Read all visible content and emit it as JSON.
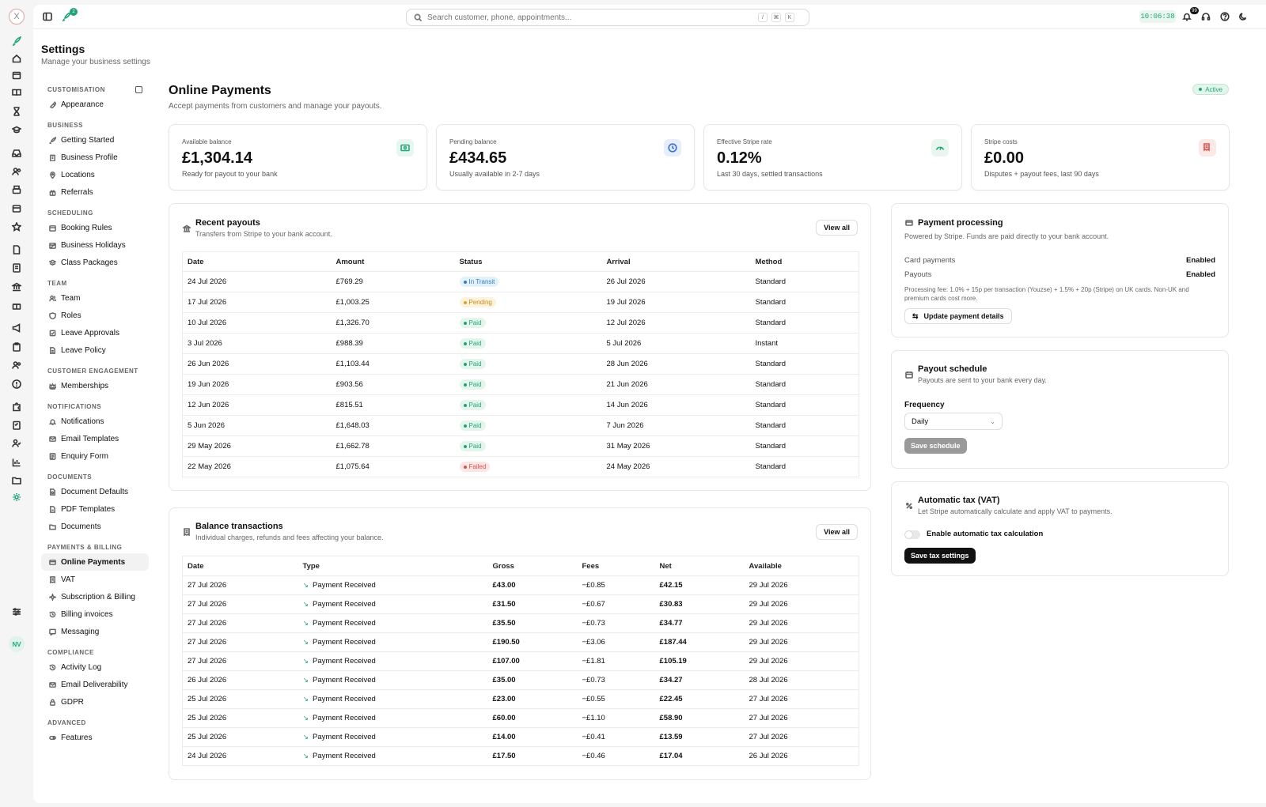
{
  "topbar": {
    "notif_count": "2",
    "search_placeholder": "Search customer, phone, appointments...",
    "kbd1": "/",
    "kbd2": "⌘",
    "kbd3": "K",
    "clock": "10:06:38",
    "bell_count": "99"
  },
  "rail": {
    "logo": "X",
    "avatar": "NV"
  },
  "settings": {
    "title": "Settings",
    "subtitle": "Manage your business settings"
  },
  "sidebar": [
    {
      "label": "CUSTOMISATION",
      "items": [
        {
          "label": "Appearance",
          "icon": "brush-icon"
        }
      ]
    },
    {
      "label": "BUSINESS",
      "items": [
        {
          "label": "Getting Started",
          "icon": "rocket-icon"
        },
        {
          "label": "Business Profile",
          "icon": "building-icon"
        },
        {
          "label": "Locations",
          "icon": "pin-icon"
        },
        {
          "label": "Referrals",
          "icon": "gift-icon"
        }
      ]
    },
    {
      "label": "SCHEDULING",
      "items": [
        {
          "label": "Booking Rules",
          "icon": "calendar-icon"
        },
        {
          "label": "Business Holidays",
          "icon": "calendar-off-icon"
        },
        {
          "label": "Class Packages",
          "icon": "layers-icon"
        }
      ]
    },
    {
      "label": "TEAM",
      "items": [
        {
          "label": "Team",
          "icon": "users-icon"
        },
        {
          "label": "Roles",
          "icon": "shield-icon"
        },
        {
          "label": "Leave Approvals",
          "icon": "check-square-icon"
        },
        {
          "label": "Leave Policy",
          "icon": "file-icon"
        }
      ]
    },
    {
      "label": "CUSTOMER ENGAGEMENT",
      "items": [
        {
          "label": "Memberships",
          "icon": "crown-icon"
        }
      ]
    },
    {
      "label": "NOTIFICATIONS",
      "items": [
        {
          "label": "Notifications",
          "icon": "bell-icon"
        },
        {
          "label": "Email Templates",
          "icon": "mail-icon"
        },
        {
          "label": "Enquiry Form",
          "icon": "form-icon"
        }
      ]
    },
    {
      "label": "DOCUMENTS",
      "items": [
        {
          "label": "Document Defaults",
          "icon": "file-settings-icon"
        },
        {
          "label": "PDF Templates",
          "icon": "pdf-icon"
        },
        {
          "label": "Documents",
          "icon": "folder-icon"
        }
      ]
    },
    {
      "label": "PAYMENTS & BILLING",
      "items": [
        {
          "label": "Online Payments",
          "icon": "credit-card-icon",
          "active": true
        },
        {
          "label": "VAT",
          "icon": "receipt-icon"
        },
        {
          "label": "Subscription & Billing",
          "icon": "sparkle-icon"
        },
        {
          "label": "Billing invoices",
          "icon": "history-icon"
        },
        {
          "label": "Messaging",
          "icon": "message-icon"
        }
      ]
    },
    {
      "label": "COMPLIANCE",
      "items": [
        {
          "label": "Activity Log",
          "icon": "history-icon"
        },
        {
          "label": "Email Deliverability",
          "icon": "mail-icon"
        },
        {
          "label": "GDPR",
          "icon": "lock-icon"
        }
      ]
    },
    {
      "label": "ADVANCED",
      "items": [
        {
          "label": "Features",
          "icon": "toggle-icon"
        }
      ]
    }
  ],
  "page": {
    "title": "Online Payments",
    "subtitle": "Accept payments from customers and manage your payouts.",
    "status": "Active"
  },
  "stats": [
    {
      "label": "Available balance",
      "value": "£1,304.14",
      "note": "Ready for payout to your bank",
      "icon": "cash-icon",
      "color": "#21a47b",
      "bg": "#e8f6ef"
    },
    {
      "label": "Pending balance",
      "value": "£434.65",
      "note": "Usually available in 2-7 days",
      "icon": "clock-icon",
      "color": "#3b6fd8",
      "bg": "#e6eefb"
    },
    {
      "label": "Effective Stripe rate",
      "value": "0.12%",
      "note": "Last 30 days, settled transactions",
      "icon": "gauge-icon",
      "color": "#21a47b",
      "bg": "#e8f6ef"
    },
    {
      "label": "Stripe costs",
      "value": "£0.00",
      "note": "Disputes + payout fees, last 90 days",
      "icon": "receipt-icon",
      "color": "#d9534f",
      "bg": "#fbe9e8"
    }
  ],
  "payouts": {
    "title": "Recent payouts",
    "subtitle": "Transfers from Stripe to your bank account.",
    "view_all": "View all",
    "columns": [
      "Date",
      "Amount",
      "Status",
      "Arrival",
      "Method"
    ],
    "rows": [
      {
        "date": "24 Jul 2026",
        "amount": "£769.29",
        "status": "In Transit",
        "arrival": "26 Jul 2026",
        "method": "Standard"
      },
      {
        "date": "17 Jul 2026",
        "amount": "£1,003.25",
        "status": "Pending",
        "arrival": "19 Jul 2026",
        "method": "Standard"
      },
      {
        "date": "10 Jul 2026",
        "amount": "£1,326.70",
        "status": "Paid",
        "arrival": "12 Jul 2026",
        "method": "Standard"
      },
      {
        "date": "3 Jul 2026",
        "amount": "£988.39",
        "status": "Paid",
        "arrival": "5 Jul 2026",
        "method": "Instant"
      },
      {
        "date": "26 Jun 2026",
        "amount": "£1,103.44",
        "status": "Paid",
        "arrival": "28 Jun 2026",
        "method": "Standard"
      },
      {
        "date": "19 Jun 2026",
        "amount": "£903.56",
        "status": "Paid",
        "arrival": "21 Jun 2026",
        "method": "Standard"
      },
      {
        "date": "12 Jun 2026",
        "amount": "£815.51",
        "status": "Paid",
        "arrival": "14 Jun 2026",
        "method": "Standard"
      },
      {
        "date": "5 Jun 2026",
        "amount": "£1,648.03",
        "status": "Paid",
        "arrival": "7 Jun 2026",
        "method": "Standard"
      },
      {
        "date": "29 May 2026",
        "amount": "£1,662.78",
        "status": "Paid",
        "arrival": "31 May 2026",
        "method": "Standard"
      },
      {
        "date": "22 May 2026",
        "amount": "£1,075.64",
        "status": "Failed",
        "arrival": "24 May 2026",
        "method": "Standard"
      }
    ]
  },
  "status_colors": {
    "In Transit": {
      "fg": "#2f7fc0",
      "bg": "#e3f1fb",
      "dot": "#2f7fc0"
    },
    "Pending": {
      "fg": "#c98a14",
      "bg": "#fdf3dd",
      "dot": "#e0a21f"
    },
    "Paid": {
      "fg": "#21a47b",
      "bg": "#e4f6ec",
      "dot": "#21a47b"
    },
    "Failed": {
      "fg": "#d9534f",
      "bg": "#fbe6e5",
      "dot": "#d9534f"
    }
  },
  "balance": {
    "title": "Balance transactions",
    "subtitle": "Individual charges, refunds and fees affecting your balance.",
    "view_all": "View all",
    "columns": [
      "Date",
      "Type",
      "Gross",
      "Fees",
      "Net",
      "Available"
    ],
    "rows": [
      {
        "date": "27 Jul 2026",
        "type": "Payment Received",
        "gross": "£43.00",
        "fees": "−£0.85",
        "net": "£42.15",
        "available": "29 Jul 2026"
      },
      {
        "date": "27 Jul 2026",
        "type": "Payment Received",
        "gross": "£31.50",
        "fees": "−£0.67",
        "net": "£30.83",
        "available": "29 Jul 2026"
      },
      {
        "date": "27 Jul 2026",
        "type": "Payment Received",
        "gross": "£35.50",
        "fees": "−£0.73",
        "net": "£34.77",
        "available": "29 Jul 2026"
      },
      {
        "date": "27 Jul 2026",
        "type": "Payment Received",
        "gross": "£190.50",
        "fees": "−£3.06",
        "net": "£187.44",
        "available": "29 Jul 2026"
      },
      {
        "date": "27 Jul 2026",
        "type": "Payment Received",
        "gross": "£107.00",
        "fees": "−£1.81",
        "net": "£105.19",
        "available": "29 Jul 2026"
      },
      {
        "date": "26 Jul 2026",
        "type": "Payment Received",
        "gross": "£35.00",
        "fees": "−£0.73",
        "net": "£34.27",
        "available": "28 Jul 2026"
      },
      {
        "date": "25 Jul 2026",
        "type": "Payment Received",
        "gross": "£23.00",
        "fees": "−£0.55",
        "net": "£22.45",
        "available": "27 Jul 2026"
      },
      {
        "date": "25 Jul 2026",
        "type": "Payment Received",
        "gross": "£60.00",
        "fees": "−£1.10",
        "net": "£58.90",
        "available": "27 Jul 2026"
      },
      {
        "date": "25 Jul 2026",
        "type": "Payment Received",
        "gross": "£14.00",
        "fees": "−£0.41",
        "net": "£13.59",
        "available": "27 Jul 2026"
      },
      {
        "date": "24 Jul 2026",
        "type": "Payment Received",
        "gross": "£17.50",
        "fees": "−£0.46",
        "net": "£17.04",
        "available": "26 Jul 2026"
      }
    ]
  },
  "processing": {
    "title": "Payment processing",
    "subtitle": "Powered by Stripe. Funds are paid directly to your bank account.",
    "card_label": "Card payments",
    "card_value": "Enabled",
    "payouts_label": "Payouts",
    "payouts_value": "Enabled",
    "fee_note": "Processing fee: 1.0% + 15p per transaction (Youzse) + 1.5% + 20p (Stripe) on UK cards. Non-UK and premium cards cost more.",
    "update_button": "Update payment details"
  },
  "schedule": {
    "title": "Payout schedule",
    "subtitle": "Payouts are sent to your bank every day.",
    "frequency_label": "Frequency",
    "frequency_value": "Daily",
    "save_button": "Save schedule"
  },
  "tax": {
    "title": "Automatic tax (VAT)",
    "subtitle": "Let Stripe automatically calculate and apply VAT to payments.",
    "toggle_label": "Enable automatic tax calculation",
    "save_button": "Save tax settings"
  }
}
